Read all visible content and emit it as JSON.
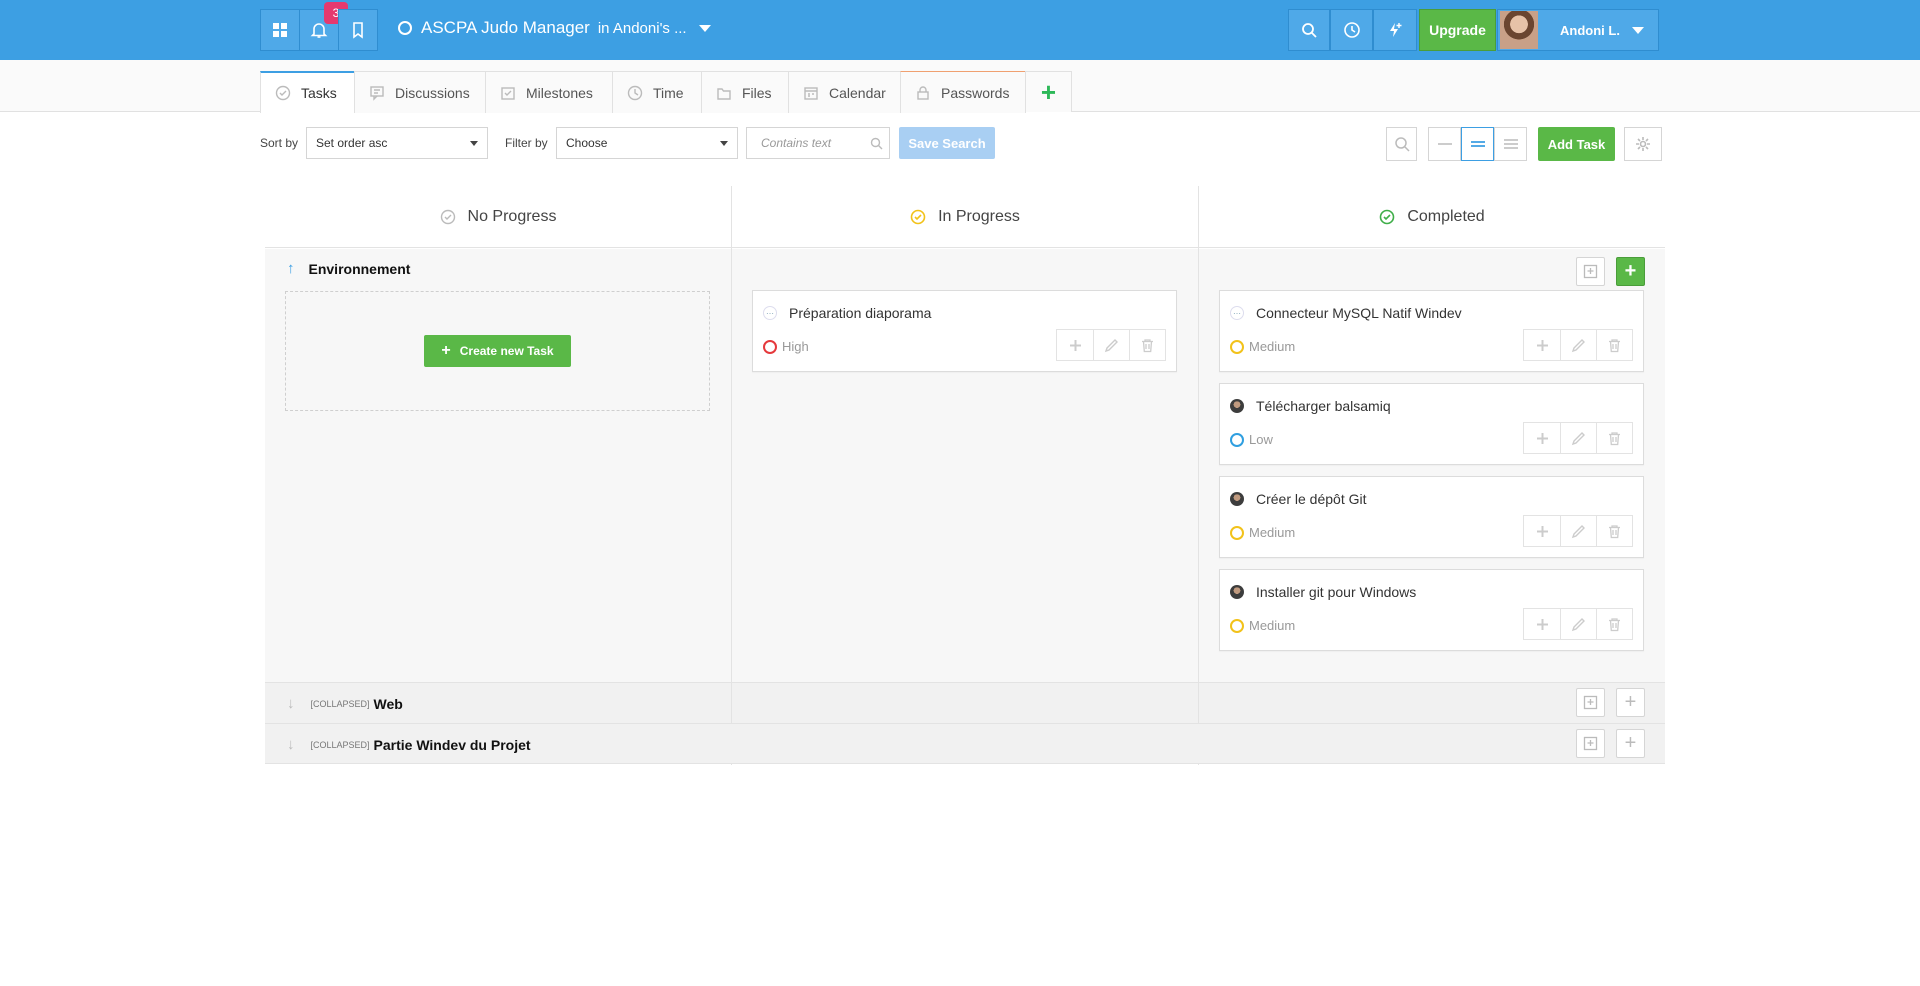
{
  "topbar": {
    "notifications_count": "3",
    "project_name": "ASCPA Judo Manager",
    "project_context": "in Andoni's ...",
    "upgrade_label": "Upgrade",
    "user_name": "Andoni L."
  },
  "tabs": [
    {
      "label": "Tasks",
      "icon": "check-circle-icon",
      "active": true
    },
    {
      "label": "Discussions",
      "icon": "discussion-icon"
    },
    {
      "label": "Milestones",
      "icon": "milestone-icon"
    },
    {
      "label": "Time",
      "icon": "clock-icon"
    },
    {
      "label": "Files",
      "icon": "folder-icon"
    },
    {
      "label": "Calendar",
      "icon": "calendar-icon"
    },
    {
      "label": "Passwords",
      "icon": "lock-icon"
    }
  ],
  "toolbar": {
    "sort_label": "Sort by",
    "sort_value": "Set order asc",
    "filter_label": "Filter by",
    "filter_value": "Choose",
    "search_placeholder": "Contains text",
    "save_search_label": "Save Search",
    "add_task_label": "Add Task"
  },
  "columns": [
    {
      "title": "No Progress",
      "color": "#bbbbbb"
    },
    {
      "title": "In Progress",
      "color": "#f2c21a"
    },
    {
      "title": "Completed",
      "color": "#3fae49"
    }
  ],
  "lanes": {
    "expanded": {
      "title": "Environnement",
      "create_label": "Create new Task",
      "in_progress": [
        {
          "title": "Préparation diaporama",
          "priority": "High",
          "priority_color": "#e5393c"
        }
      ],
      "completed": [
        {
          "title": "Connecteur MySQL Natif Windev",
          "priority": "Medium",
          "priority_color": "#f2c21a"
        },
        {
          "title": "Télécharger balsamiq",
          "priority": "Low",
          "priority_color": "#2f9fe0"
        },
        {
          "title": "Créer le dépôt Git",
          "priority": "Medium",
          "priority_color": "#f2c21a"
        },
        {
          "title": "Installer git pour Windows",
          "priority": "Medium",
          "priority_color": "#f2c21a"
        }
      ]
    },
    "collapsed_tag": "[COLLAPSED]",
    "collapsed": [
      {
        "title": "Web"
      },
      {
        "title": "Partie Windev du Projet"
      }
    ]
  },
  "colors": {
    "brand_blue": "#3d9fe3",
    "accent_green": "#5ab847",
    "notification_pink": "#e5396f"
  }
}
